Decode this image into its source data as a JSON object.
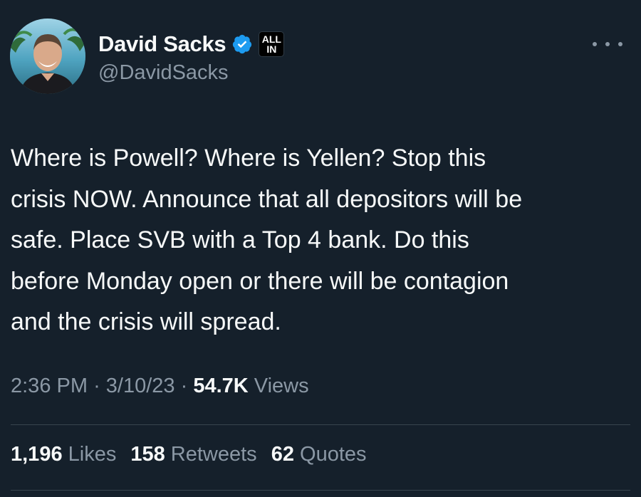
{
  "author": {
    "display_name": "David Sacks",
    "handle": "@DavidSacks",
    "verified_icon": "verified-badge-icon",
    "affiliate_badge": {
      "line1": "ALL",
      "line2": "IN"
    },
    "more_icon": "more-horizontal-icon"
  },
  "tweet": {
    "text": "Where is Powell? Where is Yellen? Stop this\ncrisis NOW. Announce that all depositors will be\nsafe. Place SVB with a Top 4 bank. Do this\nbefore Monday open or there will be contagion\nand the crisis will spread.",
    "time": "2:36 PM",
    "date": "3/10/23",
    "views_count": "54.7K",
    "views_label": "Views"
  },
  "stats": [
    {
      "count": "1,196",
      "label": "Likes"
    },
    {
      "count": "158",
      "label": "Retweets"
    },
    {
      "count": "62",
      "label": "Quotes"
    }
  ],
  "colors": {
    "background": "#15202b",
    "primary_text": "#f7f9f9",
    "secondary_text": "#8b98a5",
    "verified_blue": "#1d9bf0",
    "divider": "#38444d"
  }
}
